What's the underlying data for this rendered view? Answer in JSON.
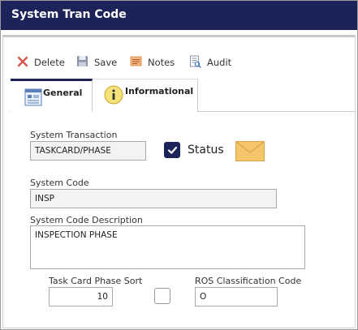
{
  "window": {
    "title": "System Tran Code"
  },
  "toolbar": {
    "delete_label": "Delete",
    "save_label": "Save",
    "notes_label": "Notes",
    "audit_label": "Audit"
  },
  "tabs": [
    {
      "label": "General",
      "active": true
    },
    {
      "label": "Informational",
      "active": false
    }
  ],
  "form": {
    "system_transaction_label": "System Transaction",
    "system_transaction_value": "TASKCARD/PHASE",
    "status_label": "Status",
    "status_checked": true,
    "system_code_label": "System Code",
    "system_code_value": "INSP",
    "system_code_description_label": "System Code Description",
    "system_code_description_value": "INSPECTION PHASE",
    "task_card_phase_sort_label": "Task Card Phase Sort",
    "task_card_phase_sort_value": "10",
    "sort_checkbox_checked": false,
    "ros_classification_code_label": "ROS Classification Code",
    "ros_classification_code_value": "O"
  },
  "colors": {
    "titlebar": "#1c2358",
    "checkbox_checked": "#1c2358",
    "delete_icon": "#d9534f",
    "envelope": "#f5c56b"
  },
  "icons": [
    "delete-x-icon",
    "save-floppy-icon",
    "notes-icon",
    "audit-icon",
    "general-form-icon",
    "info-icon",
    "checkmark-icon",
    "envelope-icon"
  ]
}
